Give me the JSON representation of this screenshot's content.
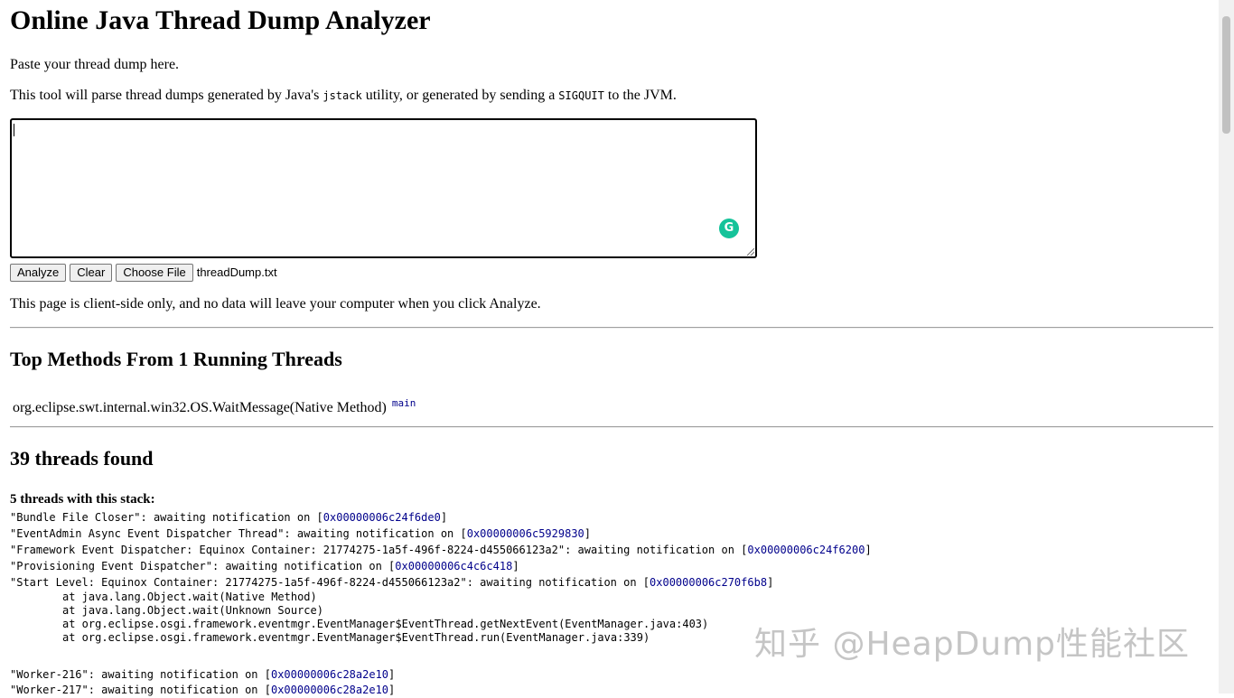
{
  "header": {
    "title": "Online Java Thread Dump Analyzer",
    "intro": "Paste your thread dump here.",
    "desc_part1": "This tool will parse thread dumps generated by Java's ",
    "desc_code1": "jstack",
    "desc_part2": " utility, or generated by sending a ",
    "desc_code2": "SIGQUIT",
    "desc_part3": " to the JVM."
  },
  "input": {
    "value": ""
  },
  "buttons": {
    "analyze": "Analyze",
    "clear": "Clear",
    "choose_file": "Choose File",
    "file_name": "threadDump.txt"
  },
  "privacy_note": "This page is client-side only, and no data will leave your computer when you click Analyze.",
  "top_methods": {
    "heading": "Top Methods From 1 Running Threads",
    "method": "org.eclipse.swt.internal.win32.OS.WaitMessage(Native Method)",
    "thread_link": "main"
  },
  "threads": {
    "heading": "39 threads found",
    "group_heading": "5 threads with this stack:",
    "group_threads": [
      {
        "prefix": "\"Bundle File Closer\": awaiting notification on [",
        "addr": "0x00000006c24f6de0",
        "suffix": "]"
      },
      {
        "prefix": "\"EventAdmin Async Event Dispatcher Thread\": awaiting notification on [",
        "addr": "0x00000006c5929830",
        "suffix": "]"
      },
      {
        "prefix": "\"Framework Event Dispatcher: Equinox Container: 21774275-1a5f-496f-8224-d455066123a2\": awaiting notification on [",
        "addr": "0x00000006c24f6200",
        "suffix": "]"
      },
      {
        "prefix": "\"Provisioning Event Dispatcher\": awaiting notification on [",
        "addr": "0x00000006c4c6c418",
        "suffix": "]"
      },
      {
        "prefix": "\"Start Level: Equinox Container: 21774275-1a5f-496f-8224-d455066123a2\": awaiting notification on [",
        "addr": "0x00000006c270f6b8",
        "suffix": "]"
      }
    ],
    "frames": [
      "at java.lang.Object.wait(Native Method)",
      "at java.lang.Object.wait(Unknown Source)",
      "at org.eclipse.osgi.framework.eventmgr.EventManager$EventThread.getNextEvent(EventManager.java:403)",
      "at org.eclipse.osgi.framework.eventmgr.EventManager$EventThread.run(EventManager.java:339)"
    ],
    "next_threads": [
      {
        "prefix": "\"Worker-216\": awaiting notification on [",
        "addr": "0x00000006c28a2e10",
        "suffix": "]"
      },
      {
        "prefix": "\"Worker-217\": awaiting notification on [",
        "addr": "0x00000006c28a2e10",
        "suffix": "]"
      }
    ]
  },
  "watermark": "知乎 @HeapDump性能社区",
  "colors": {
    "link": "#00008b",
    "grammarly": "#15c39a"
  }
}
